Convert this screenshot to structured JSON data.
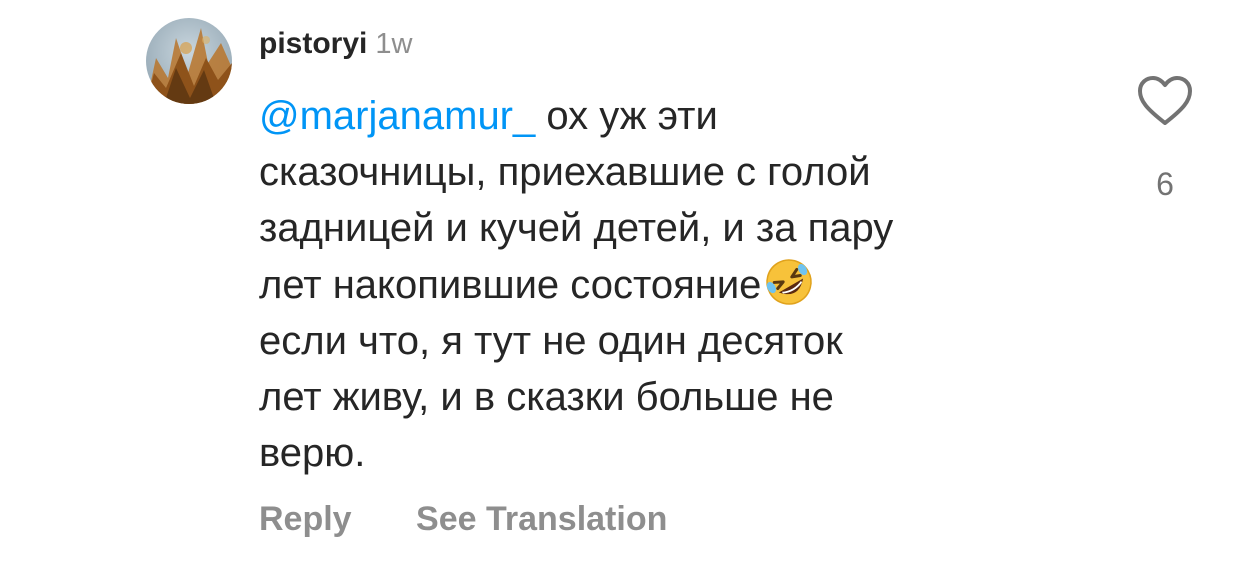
{
  "comment": {
    "username": "pistoryi",
    "time": "1w",
    "mention": "@marjanamur_",
    "line1_rest": " ох уж эти",
    "body": "сказочницы, приехавшие с голой\nзадницей и кучей детей, и за пару\nлет накопившие состояние",
    "emoji": "rolling-on-floor-laughing-emoji",
    "body2": "\nесли что, я тут не один десяток\nлет живу, и в сказки больше не\nверю."
  },
  "likes": {
    "icon": "heart-icon",
    "count": "6"
  },
  "actions": {
    "reply": "Reply",
    "see_translation": "See Translation"
  },
  "colors": {
    "mention": "#0095f6",
    "text": "#262626",
    "secondary": "#8e8e8e"
  }
}
